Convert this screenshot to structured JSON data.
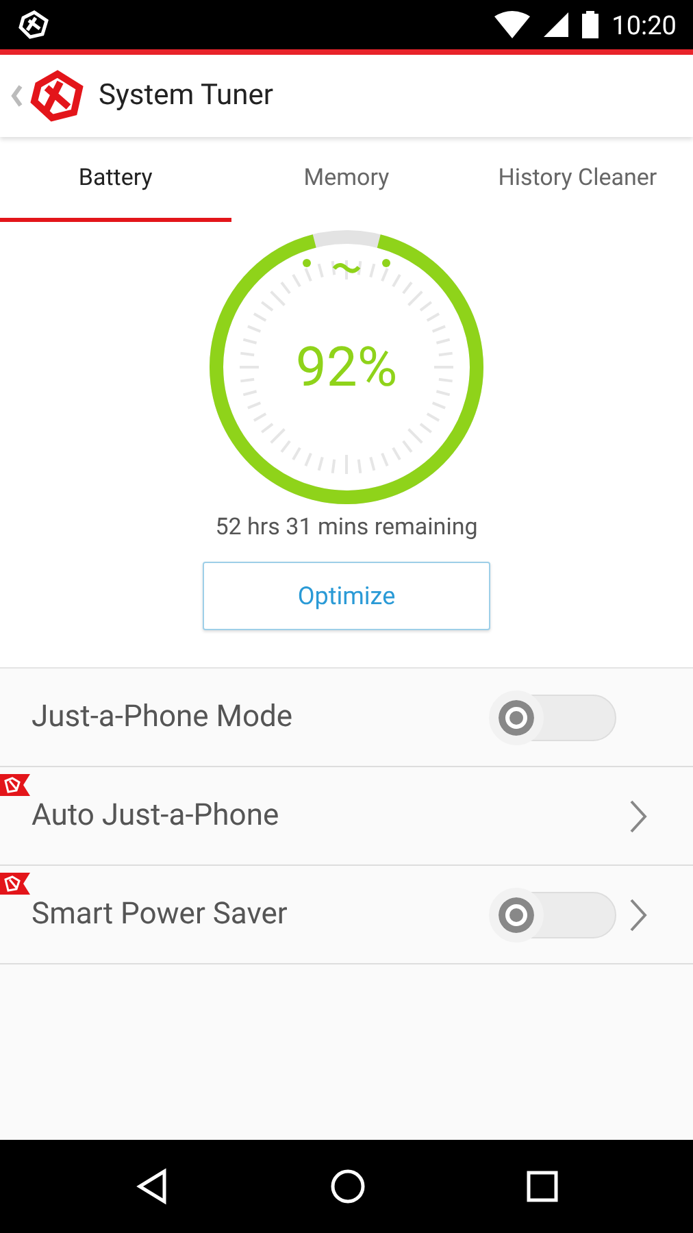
{
  "status_bar": {
    "time": "10:20"
  },
  "app_bar": {
    "title": "System Tuner"
  },
  "tabs": [
    {
      "label": "Battery",
      "selected": true
    },
    {
      "label": "Memory",
      "selected": false
    },
    {
      "label": "History Cleaner",
      "selected": false
    }
  ],
  "battery": {
    "level": 0.92,
    "percent": "92%",
    "remaining": "52 hrs 31 mins remaining",
    "button": "Optimize"
  },
  "settings": [
    {
      "label": "Just-a-Phone Mode",
      "kind": "toggle",
      "on": false,
      "badge": false
    },
    {
      "label": "Auto Just-a-Phone",
      "kind": "link",
      "badge": true
    },
    {
      "label": "Smart Power Saver",
      "kind": "toggle-link",
      "on": false,
      "badge": true
    }
  ]
}
